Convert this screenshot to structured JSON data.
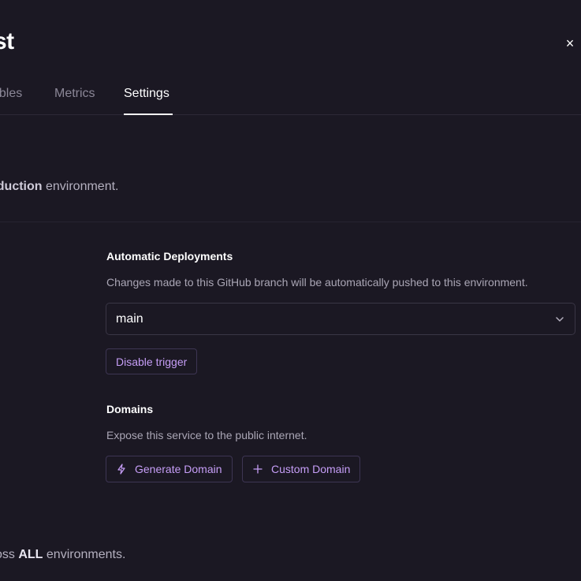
{
  "header": {
    "title": "st",
    "close_icon": "×"
  },
  "tabs": [
    {
      "label": "ables",
      "active": false
    },
    {
      "label": "Metrics",
      "active": false
    },
    {
      "label": "Settings",
      "active": true
    }
  ],
  "environment_note": {
    "bold": "oduction",
    "rest": " environment."
  },
  "automatic_deployments": {
    "label": "Automatic Deployments",
    "description": "Changes made to this GitHub branch will be automatically pushed to this environment.",
    "branch_value": "main",
    "disable_button": "Disable trigger"
  },
  "domains": {
    "label": "Domains",
    "description": "Expose this service to the public internet.",
    "generate_button": "Generate Domain",
    "generate_icon": "lightning-icon",
    "custom_button": "Custom Domain",
    "custom_icon": "plus-icon"
  },
  "footer_note": {
    "prefix": "oss ",
    "bold": "ALL",
    "rest": " environments."
  },
  "colors": {
    "background": "#1b1823",
    "accent": "#c69ef7",
    "text_primary": "#ffffff",
    "text_muted": "#8b8797"
  }
}
